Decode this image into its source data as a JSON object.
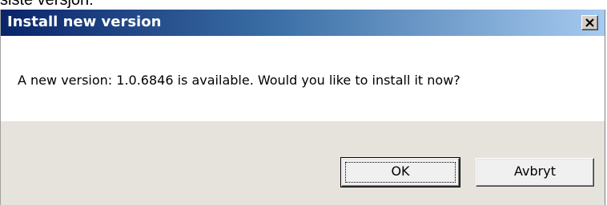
{
  "background_text": "siste versjon:",
  "dialog": {
    "title": "Install new version",
    "message": "A new version: 1.0.6846 is available. Would you like to install it now?",
    "buttons": {
      "ok_label": "OK",
      "cancel_label": "Avbryt"
    }
  },
  "colors": {
    "titlebar_start": "#0a246a",
    "titlebar_end": "#a6caf0",
    "footer_bg": "#e6e3dd"
  },
  "icons": {
    "close": "close-icon"
  }
}
